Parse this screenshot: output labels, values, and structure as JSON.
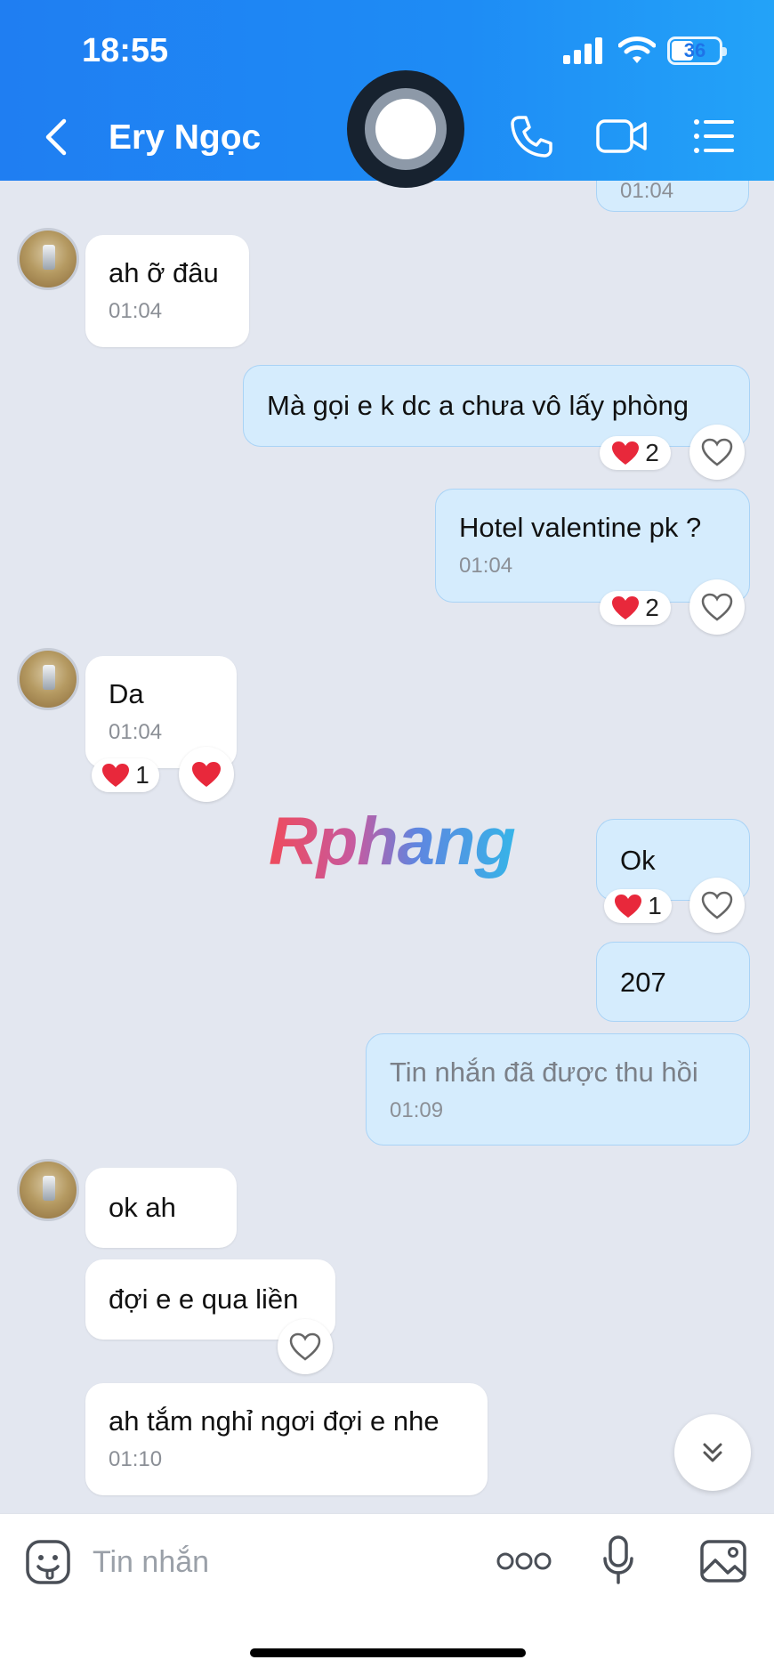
{
  "status_bar": {
    "time": "18:55",
    "battery": "36"
  },
  "header": {
    "contact_name": "Ery Ngọc"
  },
  "watermark": "Rphang",
  "messages": [
    {
      "side": "out",
      "time": "01:04",
      "partial": true
    },
    {
      "side": "in",
      "text": "ah ỡ đâu",
      "time": "01:04"
    },
    {
      "side": "out",
      "text": "Mà gọi e k dc a chưa vô lấy phòng",
      "reaction_count": "2"
    },
    {
      "side": "out",
      "text": "Hotel valentine pk ?",
      "time": "01:04",
      "reaction_count": "2"
    },
    {
      "side": "in",
      "text": "Da",
      "time": "01:04",
      "reaction_count": "1"
    },
    {
      "side": "out",
      "text": "Ok",
      "reaction_count": "1"
    },
    {
      "side": "out",
      "text": "207"
    },
    {
      "side": "out",
      "text": "Tin nhắn đã được thu hồi",
      "time": "01:09",
      "recalled": true
    },
    {
      "side": "in",
      "text": "ok ah"
    },
    {
      "side": "in",
      "text": "đợi e e qua liền"
    },
    {
      "side": "in",
      "text": "ah tắm nghỉ ngơi đợi e nhe",
      "time": "01:10"
    }
  ],
  "input_bar": {
    "placeholder": "Tin nhắn"
  },
  "colors": {
    "header": "#1e86f4",
    "outgoing_bubble": "#d5ecfd",
    "incoming_bubble": "#ffffff",
    "heart": "#e8283b"
  },
  "icons": [
    "back-icon",
    "call-icon",
    "video-call-icon",
    "menu-icon",
    "heart-icon",
    "sticker-icon",
    "more-icon",
    "microphone-icon",
    "image-icon",
    "chevron-down-icon"
  ]
}
